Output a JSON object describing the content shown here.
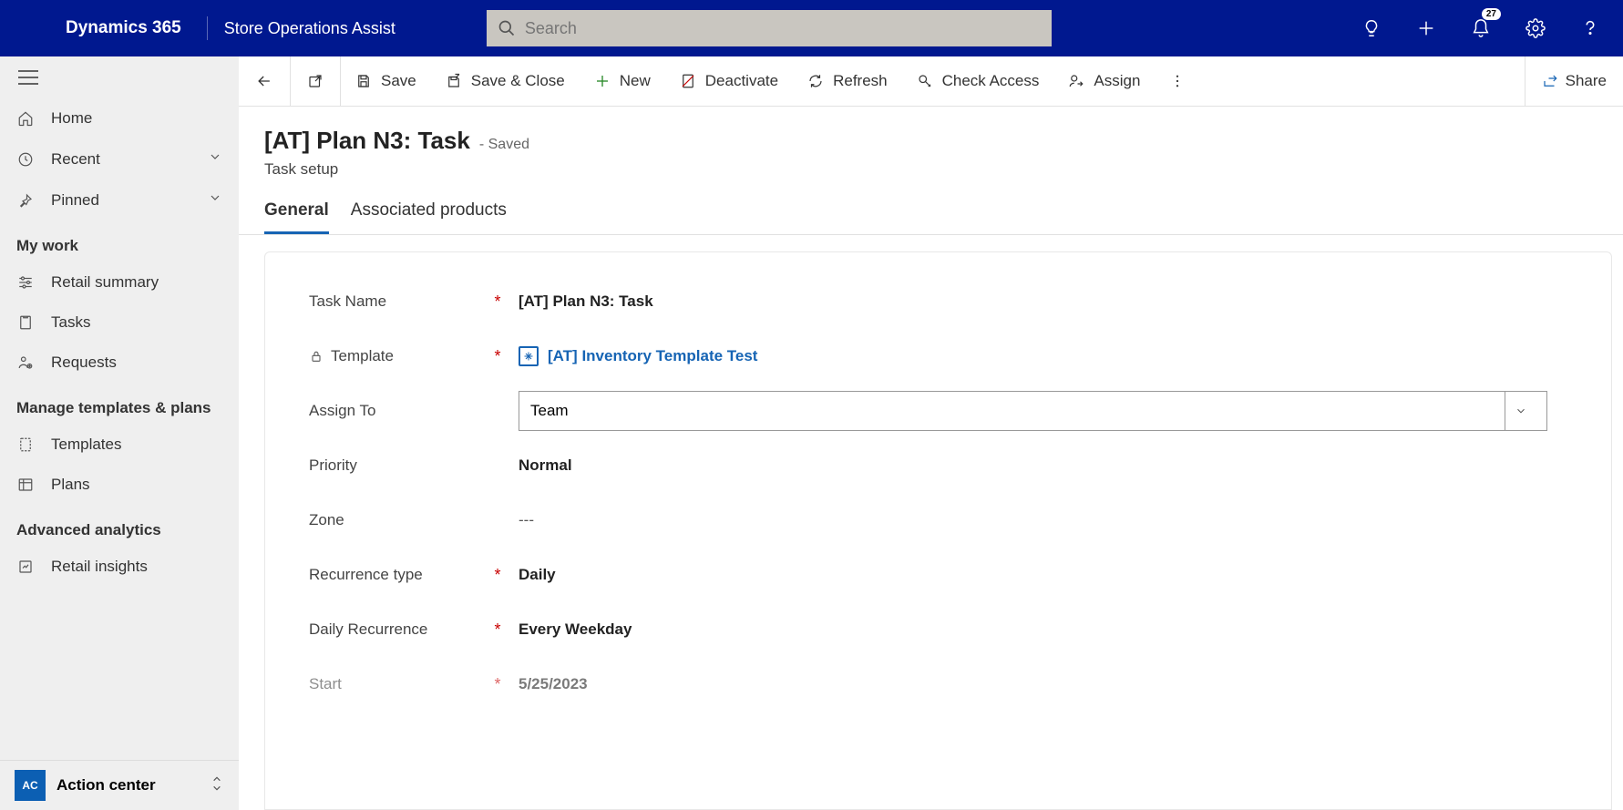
{
  "header": {
    "brand": "Dynamics 365",
    "app_name": "Store Operations Assist",
    "search_placeholder": "Search",
    "notification_count": "27"
  },
  "sidebar": {
    "home": "Home",
    "recent": "Recent",
    "pinned": "Pinned",
    "section_mywork": "My work",
    "retail_summary": "Retail summary",
    "tasks": "Tasks",
    "requests": "Requests",
    "section_manage": "Manage templates & plans",
    "templates": "Templates",
    "plans": "Plans",
    "section_advanced": "Advanced analytics",
    "retail_insights": "Retail insights",
    "app_switcher_badge": "AC",
    "app_switcher_label": "Action center"
  },
  "commands": {
    "save": "Save",
    "save_close": "Save & Close",
    "new": "New",
    "deactivate": "Deactivate",
    "refresh": "Refresh",
    "check_access": "Check Access",
    "assign": "Assign",
    "share": "Share"
  },
  "page": {
    "title": "[AT] Plan N3: Task",
    "saved_label": "- Saved",
    "subtitle": "Task setup",
    "tabs": {
      "general": "General",
      "associated": "Associated products"
    }
  },
  "form": {
    "labels": {
      "task_name": "Task Name",
      "template": "Template",
      "assign_to": "Assign To",
      "priority": "Priority",
      "zone": "Zone",
      "recurrence_type": "Recurrence type",
      "daily_recurrence": "Daily Recurrence",
      "start": "Start"
    },
    "values": {
      "task_name": "[AT] Plan N3: Task",
      "template": "[AT] Inventory Template Test",
      "assign_to": "Team",
      "priority": "Normal",
      "zone": "---",
      "recurrence_type": "Daily",
      "daily_recurrence": "Every Weekday",
      "start": "5/25/2023"
    }
  }
}
